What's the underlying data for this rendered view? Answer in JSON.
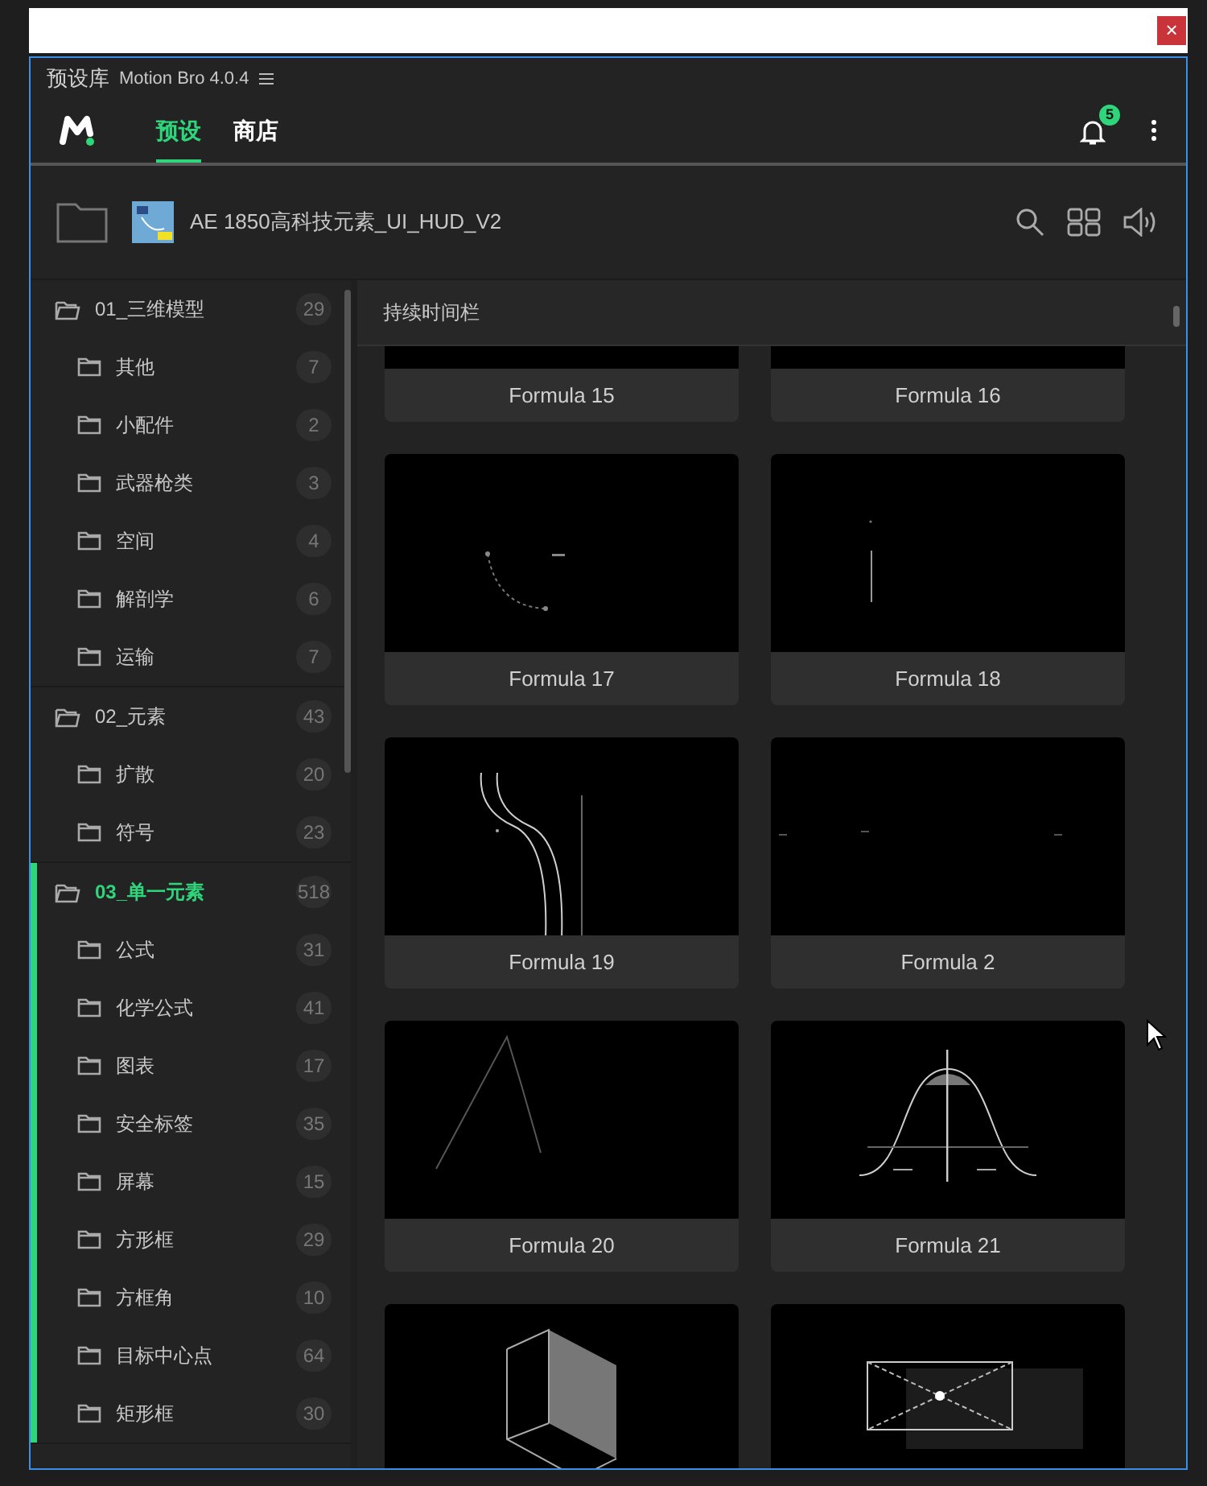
{
  "close_button": "×",
  "panel": {
    "title": "预设库",
    "app_name": "Motion Bro 4.0.4"
  },
  "tabs": [
    {
      "label": "预设",
      "selected": true
    },
    {
      "label": "商店",
      "selected": false
    }
  ],
  "notifications": {
    "count": "5"
  },
  "pack": {
    "name": "AE 1850高科技元素_UI_HUD_V2"
  },
  "sidebar": {
    "groups": [
      {
        "label": "01_三维模型",
        "count": "29",
        "selected": false,
        "children": [
          {
            "label": "其他",
            "count": "7"
          },
          {
            "label": "小配件",
            "count": "2"
          },
          {
            "label": "武器枪类",
            "count": "3"
          },
          {
            "label": "空间",
            "count": "4"
          },
          {
            "label": "解剖学",
            "count": "6"
          },
          {
            "label": "运输",
            "count": "7"
          }
        ]
      },
      {
        "label": "02_元素",
        "count": "43",
        "selected": false,
        "children": [
          {
            "label": "扩散",
            "count": "20"
          },
          {
            "label": "符号",
            "count": "23"
          }
        ]
      },
      {
        "label": "03_单一元素",
        "count": "518",
        "selected": true,
        "children": [
          {
            "label": "公式",
            "count": "31"
          },
          {
            "label": "化学公式",
            "count": "41"
          },
          {
            "label": "图表",
            "count": "17"
          },
          {
            "label": "安全标签",
            "count": "35"
          },
          {
            "label": "屏幕",
            "count": "15"
          },
          {
            "label": "方形框",
            "count": "29"
          },
          {
            "label": "方框角",
            "count": "10"
          },
          {
            "label": "目标中心点",
            "count": "64"
          },
          {
            "label": "矩形框",
            "count": "30"
          }
        ]
      }
    ]
  },
  "section": {
    "title": "持续时间栏"
  },
  "presets": [
    {
      "label": "Formula 15",
      "kind": "picture"
    },
    {
      "label": "Formula 16",
      "kind": "picture"
    },
    {
      "label": "Formula 17",
      "kind": "picture"
    },
    {
      "label": "Formula 18",
      "kind": "picture"
    },
    {
      "label": "Formula 19",
      "kind": "picture"
    },
    {
      "label": "Formula 2",
      "kind": "picture"
    },
    {
      "label": "Formula 20",
      "kind": "picture"
    },
    {
      "label": "Formula 21",
      "kind": "picture"
    },
    {
      "kind": "picture"
    },
    {
      "kind": "picture"
    }
  ]
}
